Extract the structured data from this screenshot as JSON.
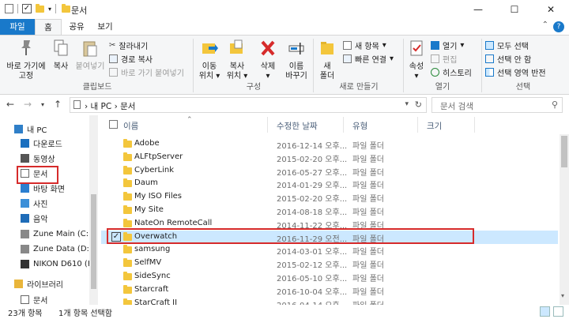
{
  "window": {
    "title": "문서",
    "min_glyph": "—",
    "max_glyph": "☐",
    "close_glyph": "✕"
  },
  "ribbon_tabs": [
    "파일",
    "홈",
    "공유",
    "보기"
  ],
  "ribbon": {
    "clipboard": {
      "pin_label_1": "바로 가기에",
      "pin_label_2": "고정",
      "copy": "복사",
      "paste": "붙여넣기",
      "cut": "잘라내기",
      "copy_path": "경로 복사",
      "paste_shortcut": "바로 가기 붙여넣기",
      "group": "클립보드"
    },
    "organize": {
      "move_1": "이동",
      "move_2": "위치",
      "copyto_1": "복사",
      "copyto_2": "위치",
      "delete": "삭제",
      "rename_1": "이름",
      "rename_2": "바꾸기",
      "group": "구성"
    },
    "new": {
      "folder_1": "새",
      "folder_2": "폴더",
      "new_item": "새 항목",
      "easy_access": "빠른 연결",
      "group": "새로 만들기"
    },
    "open": {
      "properties": "속성",
      "open": "열기",
      "edit": "편집",
      "history": "히스토리",
      "group": "열기"
    },
    "select": {
      "all": "모두 선택",
      "none": "선택 안 함",
      "invert": "선택 영역 반전",
      "group": "선택"
    }
  },
  "address": {
    "path_root": "내 PC",
    "path_leaf": "문서",
    "search_placeholder": "문서 검색"
  },
  "nav_items": [
    {
      "label": "내 PC",
      "icon": "pc-icon"
    },
    {
      "label": "다운로드",
      "icon": "download-icon"
    },
    {
      "label": "동영상",
      "icon": "video-icon"
    },
    {
      "label": "문서",
      "icon": "document-icon"
    },
    {
      "label": "바탕 화면",
      "icon": "desktop-icon"
    },
    {
      "label": "사진",
      "icon": "pictures-icon"
    },
    {
      "label": "음악",
      "icon": "music-icon"
    },
    {
      "label": "Zune Main (C:)",
      "icon": "drive-icon"
    },
    {
      "label": "Zune Data (D:)",
      "icon": "drive-icon"
    },
    {
      "label": "NIKON D610 (H",
      "icon": "camera-icon"
    },
    {
      "label": "라이브러리",
      "icon": "library-icon"
    },
    {
      "label": "문서",
      "icon": "document-icon"
    }
  ],
  "columns": [
    "이름",
    "수정한 날짜",
    "유형",
    "크기"
  ],
  "files": [
    {
      "name": "Adobe",
      "date": "2016-12-14 오후...",
      "type": "파일 폴더"
    },
    {
      "name": "ALFtpServer",
      "date": "2015-02-20 오후...",
      "type": "파일 폴더"
    },
    {
      "name": "CyberLink",
      "date": "2016-05-27 오후...",
      "type": "파일 폴더"
    },
    {
      "name": "Daum",
      "date": "2014-01-29 오후...",
      "type": "파일 폴더"
    },
    {
      "name": "My ISO Files",
      "date": "2015-02-20 오후...",
      "type": "파일 폴더"
    },
    {
      "name": "My Site",
      "date": "2014-08-18 오후...",
      "type": "파일 폴더"
    },
    {
      "name": "NateOn RemoteCall",
      "date": "2014-11-22 오후...",
      "type": "파일 폴더"
    },
    {
      "name": "Overwatch",
      "date": "2016-11-29 오전...",
      "type": "파일 폴더",
      "selected": true
    },
    {
      "name": "samsung",
      "date": "2014-03-01 오후...",
      "type": "파일 폴더"
    },
    {
      "name": "SelfMV",
      "date": "2015-02-12 오후...",
      "type": "파일 폴더"
    },
    {
      "name": "SideSync",
      "date": "2016-05-10 오후...",
      "type": "파일 폴더"
    },
    {
      "name": "Starcraft",
      "date": "2016-10-04 오후...",
      "type": "파일 폴더"
    },
    {
      "name": "StarCraft II",
      "date": "2016-04-14 오후...",
      "type": "파일 폴더"
    }
  ],
  "status": {
    "count": "23개 항목",
    "selected": "1개 항목 선택함"
  },
  "colors": {
    "accent": "#1979ca",
    "selection": "#cce8ff",
    "highlight_box": "#d62b2b",
    "folder": "#f3c63c"
  }
}
